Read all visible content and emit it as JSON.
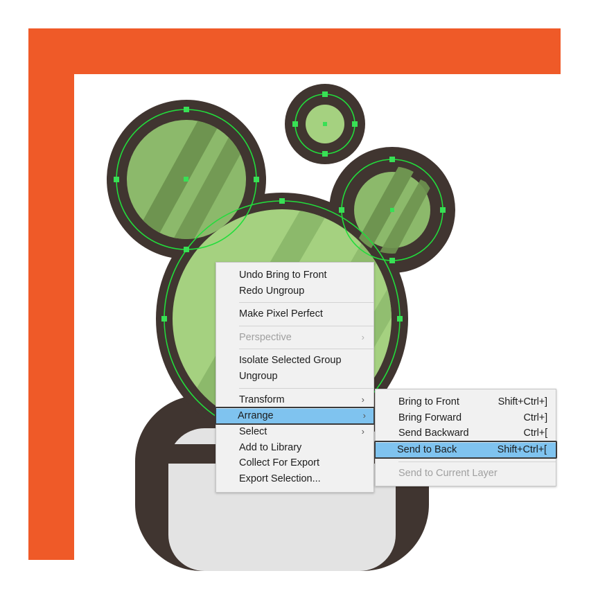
{
  "app": {
    "kind": "vector-illustration-editor",
    "canvas_background": "#ffffff",
    "frame_color": "#ef5a28"
  },
  "artwork": {
    "name": "frog-character-vector-selection",
    "colors": {
      "outline_dark": "#403530",
      "green_light": "#a5d180",
      "green_mid": "#8cb96b",
      "green_shade": "#6e9450",
      "body_gray": "#e3e3e3",
      "path_green": "#22dd3c",
      "anchor_green": "#38e055"
    },
    "selection": {
      "visible": true,
      "anchor_shape": "square",
      "paths": [
        "left-eye-circle",
        "right-eye-circle",
        "nostril-circle",
        "head-circle"
      ]
    }
  },
  "context_menu": {
    "name": "canvas-context-menu",
    "items": [
      {
        "label": "Undo Bring to Front",
        "type": "item",
        "enabled": true,
        "submenu": false,
        "accel": ""
      },
      {
        "label": "Redo Ungroup",
        "type": "item",
        "enabled": true,
        "submenu": false,
        "accel": ""
      },
      {
        "type": "separator"
      },
      {
        "label": "Make Pixel Perfect",
        "type": "item",
        "enabled": true,
        "submenu": false,
        "accel": ""
      },
      {
        "type": "separator"
      },
      {
        "label": "Perspective",
        "type": "item",
        "enabled": false,
        "submenu": true,
        "accel": ""
      },
      {
        "type": "separator"
      },
      {
        "label": "Isolate Selected Group",
        "type": "item",
        "enabled": true,
        "submenu": false,
        "accel": ""
      },
      {
        "label": "Ungroup",
        "type": "item",
        "enabled": true,
        "submenu": false,
        "accel": ""
      },
      {
        "type": "separator"
      },
      {
        "label": "Transform",
        "type": "item",
        "enabled": true,
        "submenu": true,
        "accel": ""
      },
      {
        "label": "Arrange",
        "type": "item",
        "enabled": true,
        "submenu": true,
        "accel": "",
        "highlighted": true
      },
      {
        "label": "Select",
        "type": "item",
        "enabled": true,
        "submenu": true,
        "accel": ""
      },
      {
        "label": "Add to Library",
        "type": "item",
        "enabled": true,
        "submenu": false,
        "accel": ""
      },
      {
        "label": "Collect For Export",
        "type": "item",
        "enabled": true,
        "submenu": false,
        "accel": ""
      },
      {
        "label": "Export Selection...",
        "type": "item",
        "enabled": true,
        "submenu": false,
        "accel": ""
      }
    ]
  },
  "arrange_submenu": {
    "name": "arrange-submenu",
    "items": [
      {
        "label": "Bring to Front",
        "accel": "Shift+Ctrl+]",
        "enabled": true
      },
      {
        "label": "Bring Forward",
        "accel": "Ctrl+]",
        "enabled": true
      },
      {
        "label": "Send Backward",
        "accel": "Ctrl+[",
        "enabled": true
      },
      {
        "label": "Send to Back",
        "accel": "Shift+Ctrl+[",
        "enabled": true,
        "highlighted": true
      },
      {
        "type": "separator"
      },
      {
        "label": "Send to Current Layer",
        "accel": "",
        "enabled": false
      }
    ]
  },
  "glyphs": {
    "submenu_arrow": "›"
  }
}
